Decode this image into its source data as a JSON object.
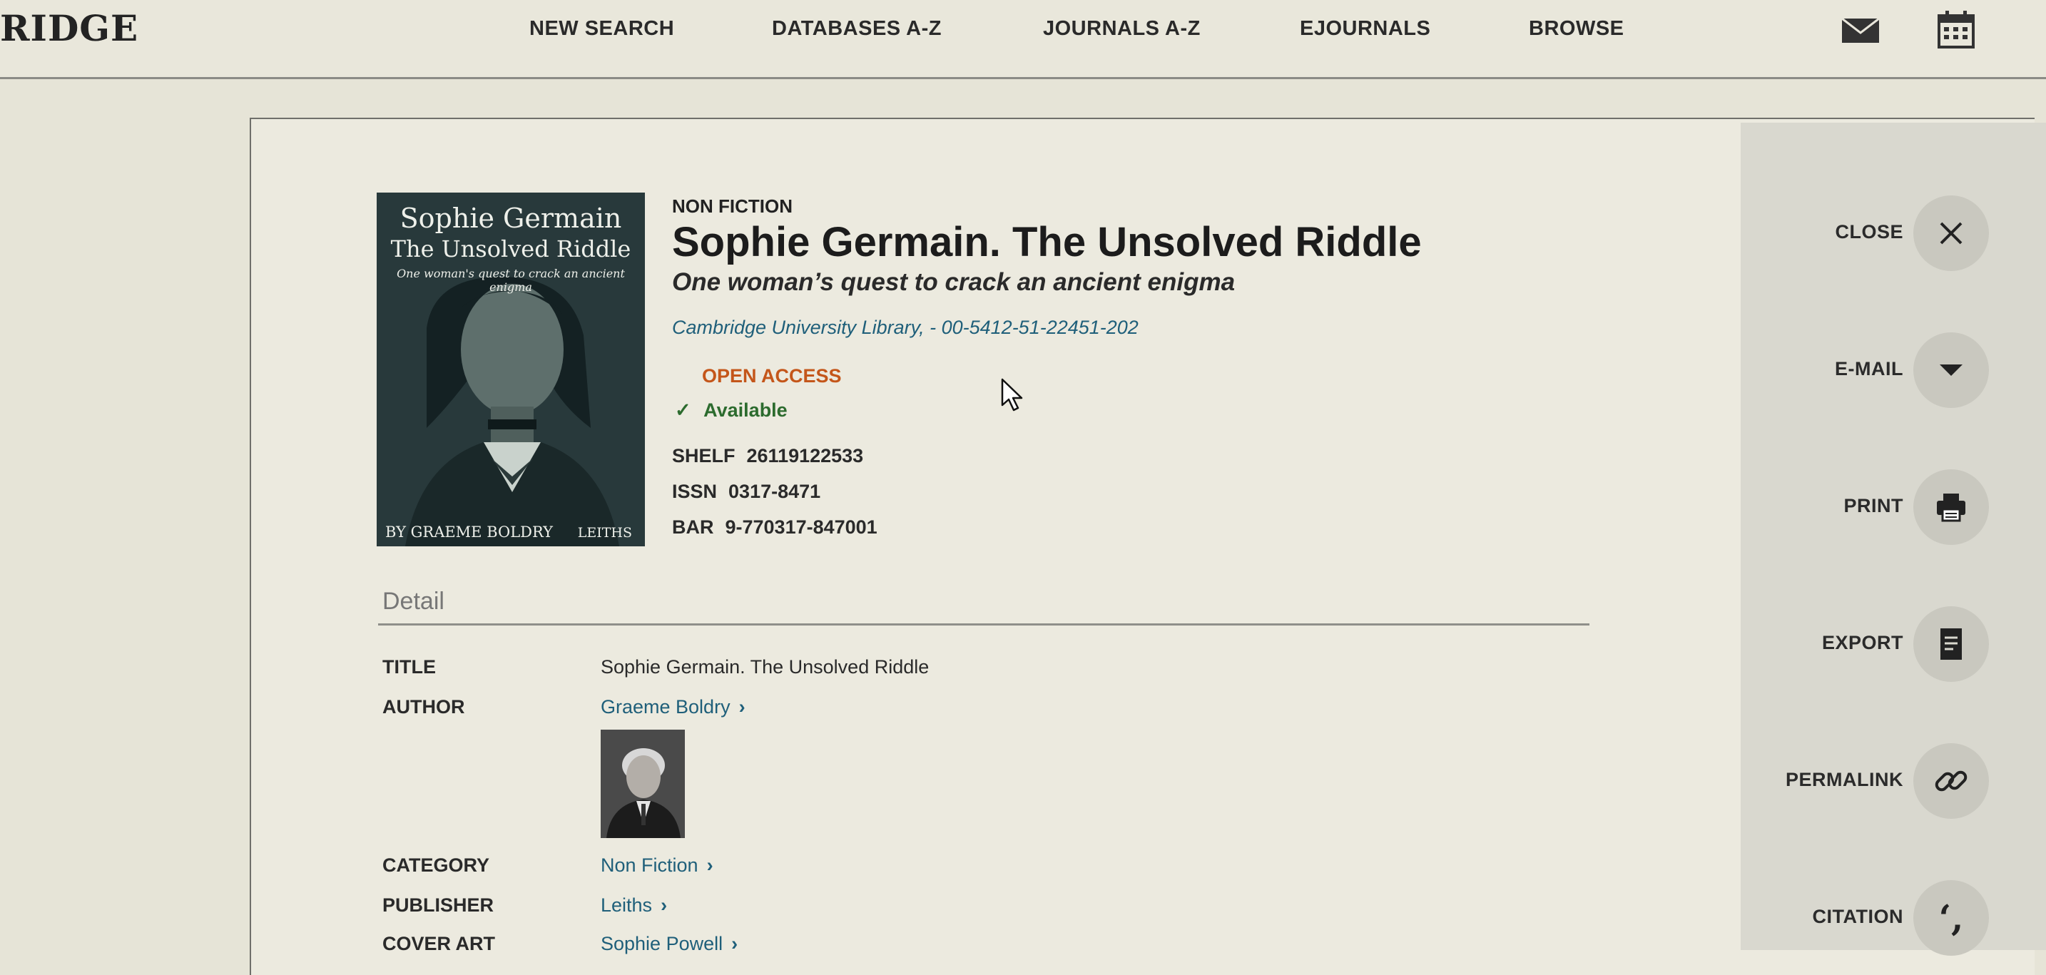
{
  "header": {
    "logo": "RIDGE",
    "nav": [
      {
        "label": "NEW SEARCH"
      },
      {
        "label": "DATABASES A-Z"
      },
      {
        "label": "JOURNALS A-Z"
      },
      {
        "label": "EJOURNALS"
      },
      {
        "label": "BROWSE"
      }
    ],
    "icons": [
      "mail-icon",
      "calendar-icon"
    ]
  },
  "record": {
    "type": "NON FICTION",
    "title": "Sophie Germain. The Unsolved Riddle",
    "subtitle": "One woman’s quest to crack an ancient enigma",
    "source": "Cambridge University Library, - 00-5412-51-22451-202",
    "access": "OPEN ACCESS",
    "availability": "Available",
    "identifiers": [
      {
        "label": "SHELF",
        "value": "26119122533"
      },
      {
        "label": "ISSN",
        "value": "0317-8471"
      },
      {
        "label": "BAR",
        "value": "9-770317-847001"
      }
    ],
    "cover": {
      "title": "Sophie Germain",
      "subtitle": "The Unsolved Riddle",
      "tagline": "One woman's quest to crack an ancient enigma",
      "author": "BY GRAEME BOLDRY",
      "publisher": "LEITHS"
    }
  },
  "detail": {
    "heading": "Detail",
    "rows": [
      {
        "label": "TITLE",
        "value": "Sophie Germain. The Unsolved Riddle"
      },
      {
        "label": "AUTHOR",
        "value": "Graeme Boldry"
      },
      {
        "label": "CATEGORY",
        "value": "Non Fiction"
      },
      {
        "label": "PUBLISHER",
        "value": "Leiths"
      },
      {
        "label": "COVER ART",
        "value": "Sophie Powell"
      }
    ]
  },
  "sidebar": {
    "actions": [
      {
        "label": "CLOSE",
        "icon": "close-icon"
      },
      {
        "label": "E-MAIL",
        "icon": "caret-down-icon"
      },
      {
        "label": "PRINT",
        "icon": "printer-icon"
      },
      {
        "label": "EXPORT",
        "icon": "document-icon"
      },
      {
        "label": "PERMALINK",
        "icon": "link-icon"
      },
      {
        "label": "CITATION",
        "icon": "quote-icon"
      }
    ]
  },
  "colors": {
    "link": "#1f5f7a",
    "open_access": "#c4561a",
    "available": "#2c6b2e",
    "background": "#e6e4d7"
  }
}
